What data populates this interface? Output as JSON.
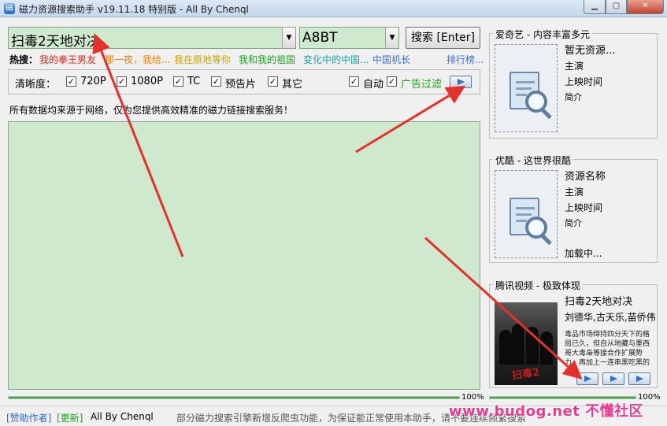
{
  "window": {
    "title": "磁力资源搜索助手 v19.11.18 特别版 - All By Chenql",
    "min_icon": "minimize-icon",
    "max_icon": "maximize-icon",
    "close_icon": "close-icon"
  },
  "search": {
    "query": "扫毒2天地对决",
    "site": "A8BT",
    "button_label": "搜索 [Enter]"
  },
  "hot": {
    "label": "热搜：",
    "items": [
      {
        "text": "我的拳王男友",
        "color": "#e0241b"
      },
      {
        "text": "那一夜，我给...",
        "color": "#e8820c"
      },
      {
        "text": "我在原地等你",
        "color": "#c9a400"
      },
      {
        "text": "我和我的祖国",
        "color": "#1fa31f"
      },
      {
        "text": "变化中的中国...",
        "color": "#17a4a4"
      },
      {
        "text": "中国机长",
        "color": "#3d6ed8"
      }
    ],
    "rank_label": "排行榜..."
  },
  "options": {
    "label": "清晰度：",
    "quality": [
      {
        "label": "720P",
        "checked": true
      },
      {
        "label": "1080P",
        "checked": true
      },
      {
        "label": "TC",
        "checked": true
      },
      {
        "label": "预告片",
        "checked": true
      },
      {
        "label": "其它",
        "checked": true
      }
    ],
    "auto": {
      "label": "自动",
      "checked": true
    },
    "ad_filter": {
      "label": "广告过滤",
      "checked": true,
      "color": "#1fa31f"
    },
    "check_mark": "✓"
  },
  "notice": "所有数据均来源于网络，仅为您提供高效精准的磁力链接搜索服务！",
  "progress": {
    "left": {
      "value": 100,
      "label": "100%"
    },
    "right": {
      "value": 100,
      "label": "100%"
    }
  },
  "status": {
    "sponsor": "[赞助作者]",
    "update": "[更新]",
    "author": "All By Chenql",
    "message": "部分磁力搜索引擎新增反爬虫功能，为保证能正常使用本助手，请不要连续频繁搜索",
    "watermark": "www.budog.net 不懂社区"
  },
  "cards": [
    {
      "title": "爱奇艺 - 内容丰富多元",
      "name": "暂无资源...",
      "actor": "主演",
      "release": "上映时间",
      "intro": "简介"
    },
    {
      "title": "优酷 - 这世界很酷",
      "name": "资源名称",
      "actor": "主演",
      "release": "上映时间",
      "intro": "简介",
      "loading": "加载中..."
    },
    {
      "title": "腾讯视频 - 极致体现",
      "name": "扫毒2天地对决",
      "actor": "刘德华,古天乐,苗侨伟",
      "synopsis": "毒品市场缔持四分天下的格局已久，但自从地藏与墨西哥大毒枭等接合作扩展势力，再加上一连串黑吃黑的动作。",
      "poster_logo": "扫毒2"
    }
  ],
  "colors": {
    "results_bg": "#cfe9cf",
    "progress_fill": "#2fb030",
    "link_blue": "#2e6bd1",
    "annotation_red": "#e8302a"
  }
}
